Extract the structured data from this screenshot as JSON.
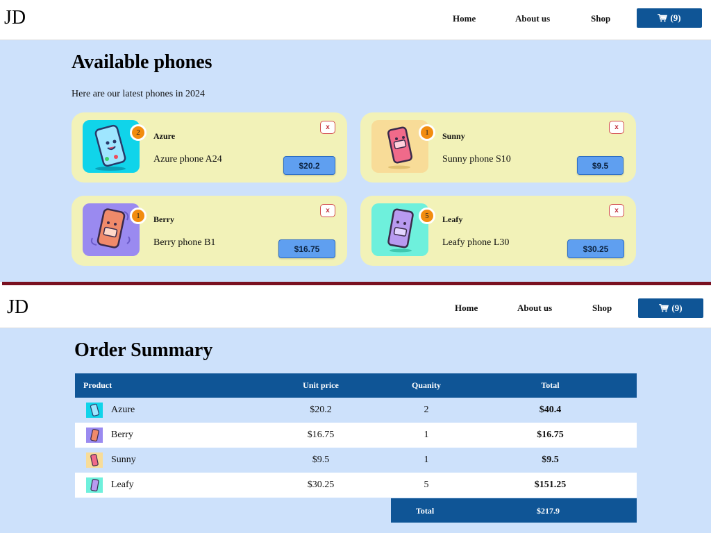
{
  "logo": "JD",
  "nav": {
    "home": "Home",
    "about": "About us",
    "shop": "Shop",
    "cart_label": "(9)"
  },
  "shop_page": {
    "title": "Available phones",
    "subtitle": "Here are our latest phones in 2024",
    "products": [
      {
        "name": "Azure",
        "description": "Azure phone A24",
        "qty": "2",
        "price": "$20.2",
        "remove": "x",
        "bg": "#10d4ea"
      },
      {
        "name": "Sunny",
        "description": "Sunny phone S10",
        "qty": "1",
        "price": "$9.5",
        "remove": "x",
        "bg": "#f8dc98"
      },
      {
        "name": "Berry",
        "description": "Berry phone B1",
        "qty": "1",
        "price": "$16.75",
        "remove": "x",
        "bg": "#9a8af0"
      },
      {
        "name": "Leafy",
        "description": "Leafy phone L30",
        "qty": "5",
        "price": "$30.25",
        "remove": "x",
        "bg": "#6ef0dc"
      }
    ]
  },
  "order_page": {
    "title": "Order Summary",
    "headers": {
      "product": "Product",
      "unit_price": "Unit price",
      "quantity": "Quanity",
      "total": "Total"
    },
    "rows": [
      {
        "product": "Azure",
        "unit_price": "$20.2",
        "quantity": "2",
        "total": "$40.4",
        "bg": "#10d4ea"
      },
      {
        "product": "Berry",
        "unit_price": "$16.75",
        "quantity": "1",
        "total": "$16.75",
        "bg": "#9a8af0"
      },
      {
        "product": "Sunny",
        "unit_price": "$9.5",
        "quantity": "1",
        "total": "$9.5",
        "bg": "#f8dc98"
      },
      {
        "product": "Leafy",
        "unit_price": "$30.25",
        "quantity": "5",
        "total": "$151.25",
        "bg": "#6ef0dc"
      }
    ],
    "total_label": "Total",
    "total_value": "$217.9"
  },
  "colors": {
    "primary": "#0f5596",
    "page_bg": "#cde1fb",
    "card_bg": "#f2f2b8",
    "badge": "#f28c0f",
    "price_button": "#5f9ff0",
    "divider": "#7a1020"
  }
}
